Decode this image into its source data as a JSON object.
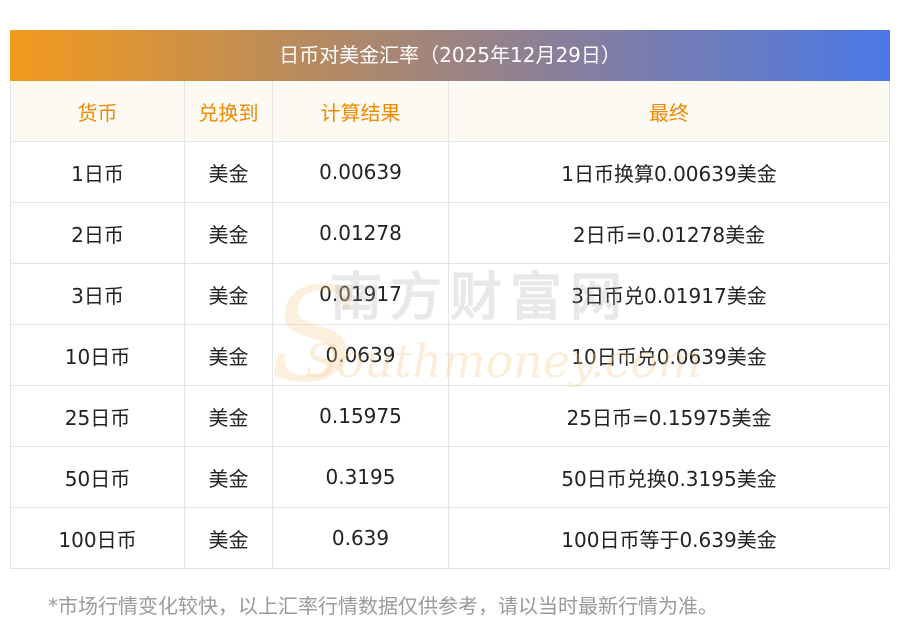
{
  "title": "日币对美金汇率（2025年12月29日）",
  "table": {
    "headers": [
      "货币",
      "兑换到",
      "计算结果",
      "最终"
    ],
    "rows": [
      [
        "1日币",
        "美金",
        "0.00639",
        "1日币换算0.00639美金"
      ],
      [
        "2日币",
        "美金",
        "0.01278",
        "2日币=0.01278美金"
      ],
      [
        "3日币",
        "美金",
        "0.01917",
        "3日币兑0.01917美金"
      ],
      [
        "10日币",
        "美金",
        "0.0639",
        "10日币兑0.0639美金"
      ],
      [
        "25日币",
        "美金",
        "0.15975",
        "25日币=0.15975美金"
      ],
      [
        "50日币",
        "美金",
        "0.3195",
        "50日币兑换0.3195美金"
      ],
      [
        "100日币",
        "美金",
        "0.639",
        "100日币等于0.639美金"
      ]
    ]
  },
  "footnote": "*市场行情变化较快，以上汇率行情数据仅供参考，请以当时最新行情为准。",
  "watermark": {
    "cn": "南方财富网",
    "en": "Southmoney.com"
  },
  "colors": {
    "header_text": "#f08a00",
    "gradient_start": "#f39a1e",
    "gradient_end": "#4b78e6"
  }
}
